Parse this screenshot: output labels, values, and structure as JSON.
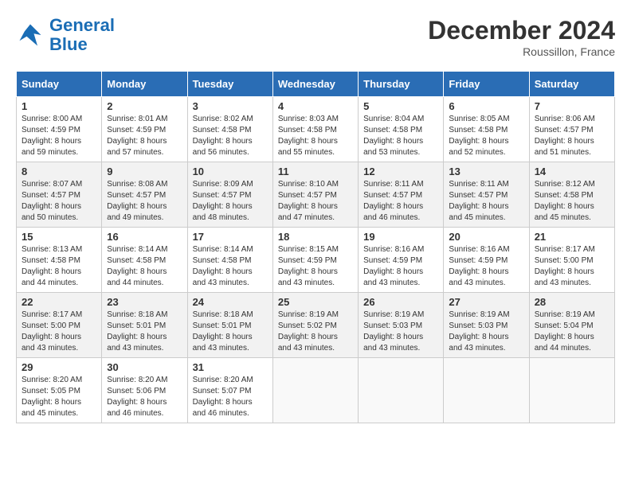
{
  "header": {
    "logo_line1": "General",
    "logo_line2": "Blue",
    "month_year": "December 2024",
    "location": "Roussillon, France"
  },
  "days_of_week": [
    "Sunday",
    "Monday",
    "Tuesday",
    "Wednesday",
    "Thursday",
    "Friday",
    "Saturday"
  ],
  "weeks": [
    [
      {
        "day": "1",
        "info": "Sunrise: 8:00 AM\nSunset: 4:59 PM\nDaylight: 8 hours\nand 59 minutes."
      },
      {
        "day": "2",
        "info": "Sunrise: 8:01 AM\nSunset: 4:59 PM\nDaylight: 8 hours\nand 57 minutes."
      },
      {
        "day": "3",
        "info": "Sunrise: 8:02 AM\nSunset: 4:58 PM\nDaylight: 8 hours\nand 56 minutes."
      },
      {
        "day": "4",
        "info": "Sunrise: 8:03 AM\nSunset: 4:58 PM\nDaylight: 8 hours\nand 55 minutes."
      },
      {
        "day": "5",
        "info": "Sunrise: 8:04 AM\nSunset: 4:58 PM\nDaylight: 8 hours\nand 53 minutes."
      },
      {
        "day": "6",
        "info": "Sunrise: 8:05 AM\nSunset: 4:58 PM\nDaylight: 8 hours\nand 52 minutes."
      },
      {
        "day": "7",
        "info": "Sunrise: 8:06 AM\nSunset: 4:57 PM\nDaylight: 8 hours\nand 51 minutes."
      }
    ],
    [
      {
        "day": "8",
        "info": "Sunrise: 8:07 AM\nSunset: 4:57 PM\nDaylight: 8 hours\nand 50 minutes."
      },
      {
        "day": "9",
        "info": "Sunrise: 8:08 AM\nSunset: 4:57 PM\nDaylight: 8 hours\nand 49 minutes."
      },
      {
        "day": "10",
        "info": "Sunrise: 8:09 AM\nSunset: 4:57 PM\nDaylight: 8 hours\nand 48 minutes."
      },
      {
        "day": "11",
        "info": "Sunrise: 8:10 AM\nSunset: 4:57 PM\nDaylight: 8 hours\nand 47 minutes."
      },
      {
        "day": "12",
        "info": "Sunrise: 8:11 AM\nSunset: 4:57 PM\nDaylight: 8 hours\nand 46 minutes."
      },
      {
        "day": "13",
        "info": "Sunrise: 8:11 AM\nSunset: 4:57 PM\nDaylight: 8 hours\nand 45 minutes."
      },
      {
        "day": "14",
        "info": "Sunrise: 8:12 AM\nSunset: 4:58 PM\nDaylight: 8 hours\nand 45 minutes."
      }
    ],
    [
      {
        "day": "15",
        "info": "Sunrise: 8:13 AM\nSunset: 4:58 PM\nDaylight: 8 hours\nand 44 minutes."
      },
      {
        "day": "16",
        "info": "Sunrise: 8:14 AM\nSunset: 4:58 PM\nDaylight: 8 hours\nand 44 minutes."
      },
      {
        "day": "17",
        "info": "Sunrise: 8:14 AM\nSunset: 4:58 PM\nDaylight: 8 hours\nand 43 minutes."
      },
      {
        "day": "18",
        "info": "Sunrise: 8:15 AM\nSunset: 4:59 PM\nDaylight: 8 hours\nand 43 minutes."
      },
      {
        "day": "19",
        "info": "Sunrise: 8:16 AM\nSunset: 4:59 PM\nDaylight: 8 hours\nand 43 minutes."
      },
      {
        "day": "20",
        "info": "Sunrise: 8:16 AM\nSunset: 4:59 PM\nDaylight: 8 hours\nand 43 minutes."
      },
      {
        "day": "21",
        "info": "Sunrise: 8:17 AM\nSunset: 5:00 PM\nDaylight: 8 hours\nand 43 minutes."
      }
    ],
    [
      {
        "day": "22",
        "info": "Sunrise: 8:17 AM\nSunset: 5:00 PM\nDaylight: 8 hours\nand 43 minutes."
      },
      {
        "day": "23",
        "info": "Sunrise: 8:18 AM\nSunset: 5:01 PM\nDaylight: 8 hours\nand 43 minutes."
      },
      {
        "day": "24",
        "info": "Sunrise: 8:18 AM\nSunset: 5:01 PM\nDaylight: 8 hours\nand 43 minutes."
      },
      {
        "day": "25",
        "info": "Sunrise: 8:19 AM\nSunset: 5:02 PM\nDaylight: 8 hours\nand 43 minutes."
      },
      {
        "day": "26",
        "info": "Sunrise: 8:19 AM\nSunset: 5:03 PM\nDaylight: 8 hours\nand 43 minutes."
      },
      {
        "day": "27",
        "info": "Sunrise: 8:19 AM\nSunset: 5:03 PM\nDaylight: 8 hours\nand 43 minutes."
      },
      {
        "day": "28",
        "info": "Sunrise: 8:19 AM\nSunset: 5:04 PM\nDaylight: 8 hours\nand 44 minutes."
      }
    ],
    [
      {
        "day": "29",
        "info": "Sunrise: 8:20 AM\nSunset: 5:05 PM\nDaylight: 8 hours\nand 45 minutes."
      },
      {
        "day": "30",
        "info": "Sunrise: 8:20 AM\nSunset: 5:06 PM\nDaylight: 8 hours\nand 46 minutes."
      },
      {
        "day": "31",
        "info": "Sunrise: 8:20 AM\nSunset: 5:07 PM\nDaylight: 8 hours\nand 46 minutes."
      },
      null,
      null,
      null,
      null
    ]
  ]
}
